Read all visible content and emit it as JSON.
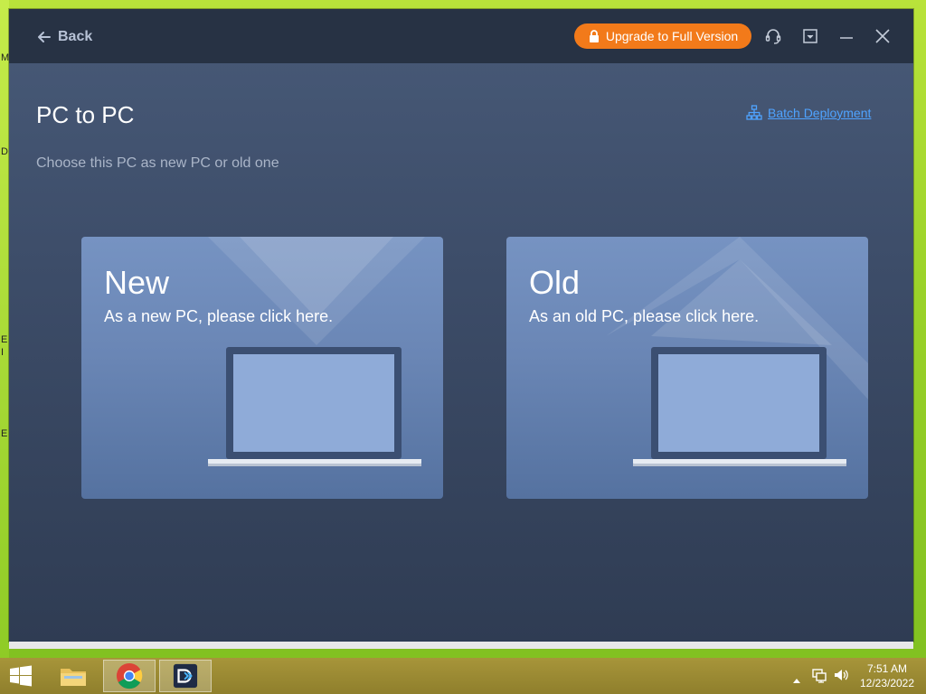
{
  "window": {
    "back_label": "Back",
    "upgrade_label": "Upgrade to Full Version"
  },
  "page": {
    "title": "PC to PC",
    "subtitle": "Choose this PC as new PC or old one",
    "batch_label": "Batch Deployment"
  },
  "cards": [
    {
      "title": "New",
      "desc": "As a new PC, please click here."
    },
    {
      "title": "Old",
      "desc": "As an old PC, please click here."
    }
  ],
  "taskbar": {
    "time": "7:51 AM",
    "date": "12/23/2022"
  },
  "desktop": {
    "edge_letters": [
      "M",
      "D",
      "E",
      "I",
      "E"
    ]
  },
  "colors": {
    "accent_orange": "#f27a1a",
    "link_blue": "#4fa3ff",
    "titlebar": "#273244"
  }
}
